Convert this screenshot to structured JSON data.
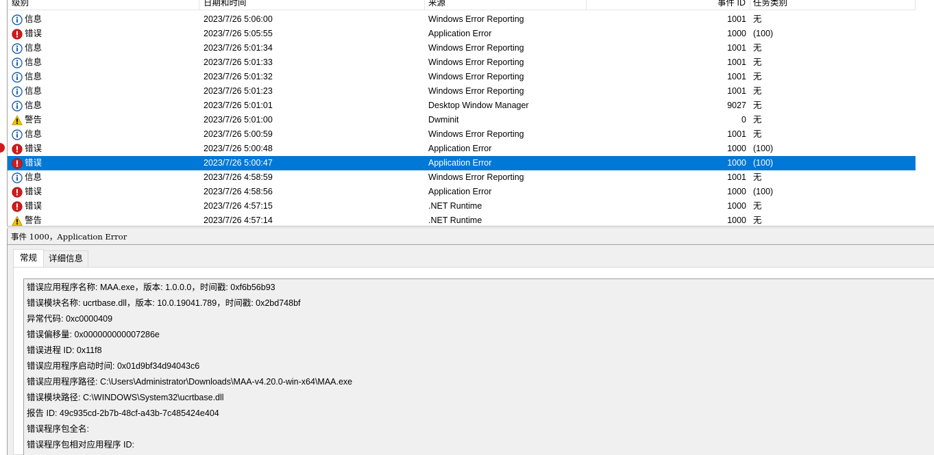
{
  "columns": {
    "level": "级别",
    "date": "日期和时间",
    "source": "来源",
    "event_id": "事件 ID",
    "category": "任务类别"
  },
  "events": [
    {
      "level": "信息",
      "icon": "info-icon",
      "date": "2023/7/26 5:06:00",
      "source": "Windows Error Reporting",
      "id": "1001",
      "category": "无"
    },
    {
      "level": "错误",
      "icon": "error-icon",
      "date": "2023/7/26 5:05:55",
      "source": "Application Error",
      "id": "1000",
      "category": "(100)"
    },
    {
      "level": "信息",
      "icon": "info-icon",
      "date": "2023/7/26 5:01:34",
      "source": "Windows Error Reporting",
      "id": "1001",
      "category": "无"
    },
    {
      "level": "信息",
      "icon": "info-icon",
      "date": "2023/7/26 5:01:33",
      "source": "Windows Error Reporting",
      "id": "1001",
      "category": "无"
    },
    {
      "level": "信息",
      "icon": "info-icon",
      "date": "2023/7/26 5:01:32",
      "source": "Windows Error Reporting",
      "id": "1001",
      "category": "无"
    },
    {
      "level": "信息",
      "icon": "info-icon",
      "date": "2023/7/26 5:01:23",
      "source": "Windows Error Reporting",
      "id": "1001",
      "category": "无"
    },
    {
      "level": "信息",
      "icon": "info-icon",
      "date": "2023/7/26 5:01:01",
      "source": "Desktop Window Manager",
      "id": "9027",
      "category": "无"
    },
    {
      "level": "警告",
      "icon": "warning-icon",
      "date": "2023/7/26 5:01:00",
      "source": "Dwminit",
      "id": "0",
      "category": "无"
    },
    {
      "level": "信息",
      "icon": "info-icon",
      "date": "2023/7/26 5:00:59",
      "source": "Windows Error Reporting",
      "id": "1001",
      "category": "无"
    },
    {
      "level": "错误",
      "icon": "error-icon",
      "date": "2023/7/26 5:00:48",
      "source": "Application Error",
      "id": "1000",
      "category": "(100)"
    },
    {
      "level": "错误",
      "icon": "error-icon",
      "date": "2023/7/26 5:00:47",
      "source": "Application Error",
      "id": "1000",
      "category": "(100)",
      "selected": true
    },
    {
      "level": "信息",
      "icon": "info-icon",
      "date": "2023/7/26 4:58:59",
      "source": "Windows Error Reporting",
      "id": "1001",
      "category": "无"
    },
    {
      "level": "错误",
      "icon": "error-icon",
      "date": "2023/7/26 4:58:56",
      "source": "Application Error",
      "id": "1000",
      "category": "(100)"
    },
    {
      "level": "错误",
      "icon": "error-icon",
      "date": "2023/7/26 4:57:15",
      "source": ".NET Runtime",
      "id": "1000",
      "category": "无"
    },
    {
      "level": "警告",
      "icon": "warning-icon",
      "date": "2023/7/26 4:57:14",
      "source": ".NET Runtime",
      "id": "1000",
      "category": "无"
    }
  ],
  "details": {
    "title": "事件 1000，Application Error",
    "tabs": [
      "常规",
      "详细信息"
    ],
    "active_tab": "常规",
    "lines": [
      "错误应用程序名称: MAA.exe，版本: 1.0.0.0，时间戳: 0xf6b56b93",
      "错误模块名称: ucrtbase.dll，版本: 10.0.19041.789，时间戳: 0x2bd748bf",
      "异常代码: 0xc0000409",
      "错误偏移量: 0x000000000007286e",
      "错误进程 ID: 0x11f8",
      "错误应用程序启动时间: 0x01d9bf34d94043c6",
      "错误应用程序路径: C:\\Users\\Administrator\\Downloads\\MAA-v4.20.0-win-x64\\MAA.exe",
      "错误模块路径: C:\\WINDOWS\\System32\\ucrtbase.dll",
      "报告 ID: 49c935cd-2b7b-48cf-a43b-7c485424e404",
      "错误程序包全名:",
      "错误程序包相对应用程序 ID:"
    ]
  },
  "colors": {
    "selection": "#0078d7",
    "info_icon": "#1c5fb0",
    "error_icon": "#d11c1c",
    "warning_icon": "#f2c200"
  }
}
